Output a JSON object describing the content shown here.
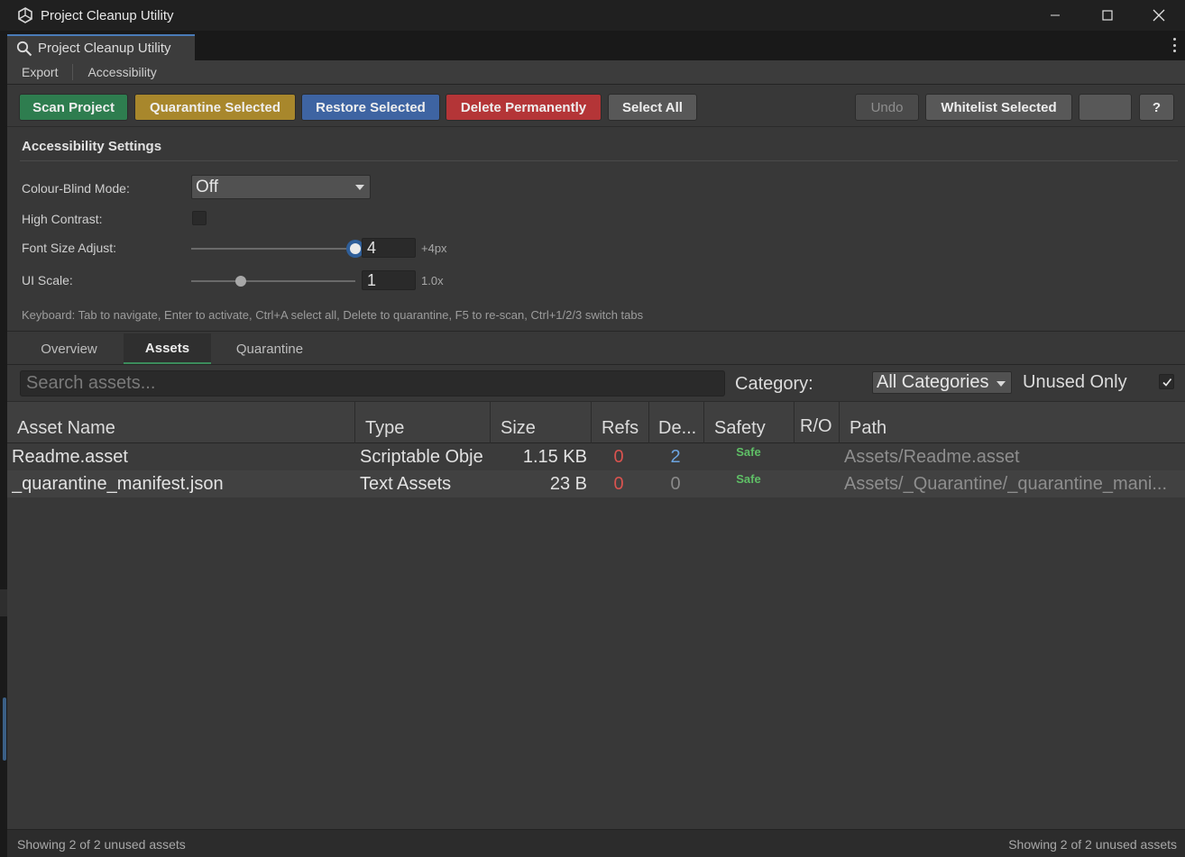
{
  "window": {
    "title": "Project Cleanup Utility",
    "controls": {
      "minimize_icon": "minimize-icon",
      "maximize_icon": "maximize-icon",
      "close_icon": "close-icon"
    }
  },
  "tab": {
    "label": "Project Cleanup Utility",
    "icon": "search-icon"
  },
  "menu": {
    "items": [
      "Export",
      "Accessibility"
    ]
  },
  "toolbar": {
    "scan": "Scan Project",
    "quarantine": "Quarantine Selected",
    "restore": "Restore Selected",
    "delete": "Delete Permanently",
    "select_all": "Select All",
    "undo": "Undo",
    "whitelist": "Whitelist Selected",
    "blank": "",
    "help": "?"
  },
  "accessibility": {
    "heading": "Accessibility Settings",
    "colour_blind_label": "Colour-Blind Mode:",
    "colour_blind_value": "Off",
    "high_contrast_label": "High Contrast:",
    "high_contrast_checked": false,
    "font_size_label": "Font Size Adjust:",
    "font_size_value": "4",
    "font_size_unit": "+4px",
    "font_size_fraction": 1.0,
    "ui_scale_label": "UI Scale:",
    "ui_scale_value": "1",
    "ui_scale_unit": "1.0x",
    "ui_scale_fraction": 0.3,
    "hint": "Keyboard: Tab to navigate, Enter to activate, Ctrl+A select all, Delete to quarantine, F5 to re-scan, Ctrl+1/2/3 switch tabs"
  },
  "content_tabs": [
    "Overview",
    "Assets",
    "Quarantine"
  ],
  "active_tab": "Assets",
  "filters": {
    "search_placeholder": "Search assets...",
    "category_label": "Category:",
    "category_value": "All Categories",
    "unused_only_label": "Unused Only",
    "unused_only_checked": true
  },
  "table": {
    "columns": [
      "Asset Name",
      "Type",
      "Size",
      "Refs",
      "De...",
      "Safety",
      "R/O",
      "Path"
    ],
    "rows": [
      {
        "name": "Readme.asset",
        "type": "Scriptable Obje",
        "size": "1.15 KB",
        "refs": "0",
        "deps": "2",
        "safety": "Safe",
        "ro": "",
        "path": "Assets/Readme.asset"
      },
      {
        "name": "_quarantine_manifest.json",
        "type": "Text Assets",
        "size": "23 B",
        "refs": "0",
        "deps": "0",
        "safety": "Safe",
        "ro": "",
        "path": "Assets/_Quarantine/_quarantine_mani..."
      }
    ]
  },
  "status": {
    "left": "Showing 2 of 2 unused assets",
    "right": "Showing 2 of 2 unused assets"
  },
  "colors": {
    "scan": "#2e7d4f",
    "quarantine": "#a8872c",
    "restore": "#3e64a2",
    "delete": "#b43537",
    "safe": "#5fbf66",
    "refs_zero": "#d9534f",
    "deps_nonzero": "#6ca4e0"
  }
}
